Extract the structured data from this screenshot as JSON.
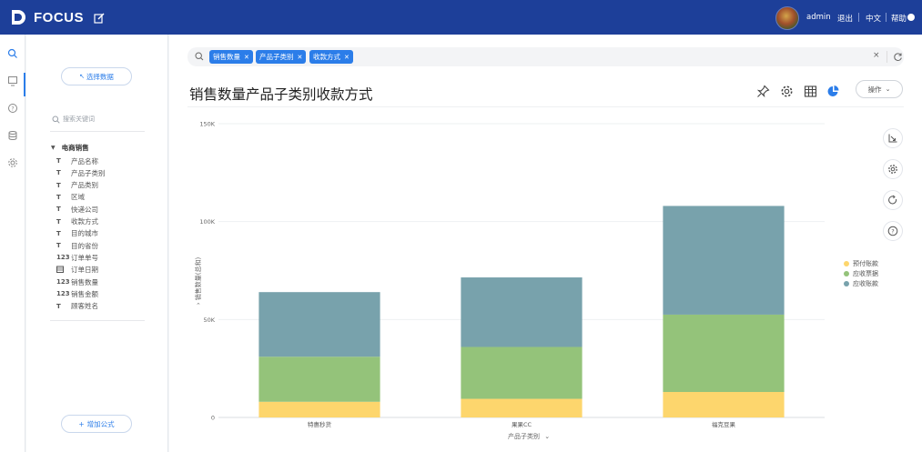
{
  "app": {
    "name": "FOCUS"
  },
  "topbar": {
    "user": "admin",
    "logout": "退出",
    "language": "中文",
    "help": "帮助"
  },
  "sidebar": {
    "select_data_label": "选择数据",
    "search_placeholder": "搜索关键词",
    "root_label": "电商销售",
    "fields": [
      {
        "type": "T",
        "label": "产品名称"
      },
      {
        "type": "T",
        "label": "产品子类别"
      },
      {
        "type": "T",
        "label": "产品类别"
      },
      {
        "type": "T",
        "label": "区域"
      },
      {
        "type": "T",
        "label": "快递公司"
      },
      {
        "type": "T",
        "label": "收款方式"
      },
      {
        "type": "T",
        "label": "目的城市"
      },
      {
        "type": "T",
        "label": "目的省份"
      },
      {
        "type": "123",
        "label": "订单单号"
      },
      {
        "type": "date",
        "label": "订单日期"
      },
      {
        "type": "123",
        "label": "销售数量"
      },
      {
        "type": "123",
        "label": "销售金额"
      },
      {
        "type": "T",
        "label": "顾客姓名"
      }
    ],
    "add_formula_label": "增加公式"
  },
  "query": {
    "tokens": [
      "销售数量",
      "产品子类别",
      "收款方式"
    ],
    "clear": "×"
  },
  "page_title": "销售数量产品子类别收款方式",
  "action_label": "操作",
  "icons": {
    "pin": "pin-icon",
    "settings": "gear-icon",
    "table": "table-icon",
    "pie": "pie-chart-icon",
    "axis": "axis-icon",
    "refresh": "refresh-icon",
    "help": "help-icon"
  },
  "colors": {
    "brand": "#1d3f99",
    "accent": "#2b7de9",
    "series_1": "#fdd66d",
    "series_2": "#94c37a",
    "series_3": "#78a2ac"
  },
  "chart_data": {
    "type": "bar",
    "stacked": true,
    "categories": [
      "特惠秒货",
      "果果CC",
      "福克豆果"
    ],
    "series": [
      {
        "name": "预付账款",
        "values": [
          8000,
          9500,
          13000
        ]
      },
      {
        "name": "应收票据",
        "values": [
          23000,
          26500,
          39500
        ]
      },
      {
        "name": "应收账款",
        "values": [
          33000,
          35500,
          55500
        ]
      }
    ],
    "yticks": [
      0,
      50000,
      100000,
      150000
    ],
    "ytick_labels": [
      "0",
      "50K",
      "100K",
      "150K"
    ],
    "ylim": [
      0,
      150000
    ],
    "ylabel": "销售数量(总和)",
    "xlabel": "产品子类别",
    "legend_position": "right",
    "grid": true
  }
}
